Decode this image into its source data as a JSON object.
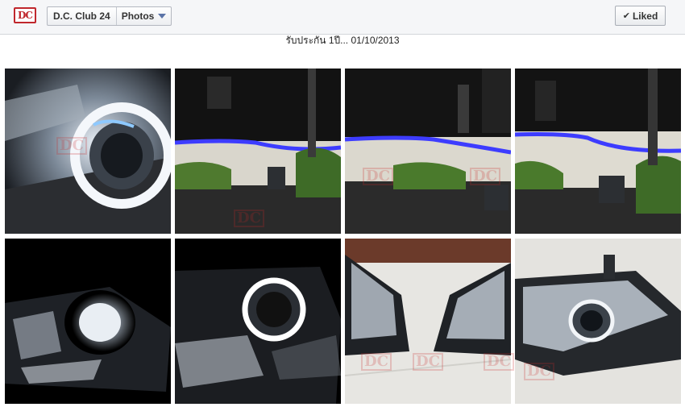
{
  "header": {
    "logo_text": "DC",
    "page_name": "D.C. Club 24",
    "section": "Photos",
    "liked_label": "Liked"
  },
  "album": {
    "caption": "รับประกัน 1ปี... 01/10/2013"
  },
  "photos": [
    {
      "subject": "projector-headlight-closeup"
    },
    {
      "subject": "headlight-beam-on-wall"
    },
    {
      "subject": "headlight-beam-on-wall"
    },
    {
      "subject": "headlight-beam-on-wall"
    },
    {
      "subject": "projector-lit-dark"
    },
    {
      "subject": "angel-eye-ring-lit"
    },
    {
      "subject": "headlight-pair-on-floor"
    },
    {
      "subject": "headlight-assembly-on-floor"
    }
  ],
  "colors": {
    "accent": "#5b74a8",
    "brand_red": "#c0272d",
    "beam_blue": "#3d3cff"
  }
}
